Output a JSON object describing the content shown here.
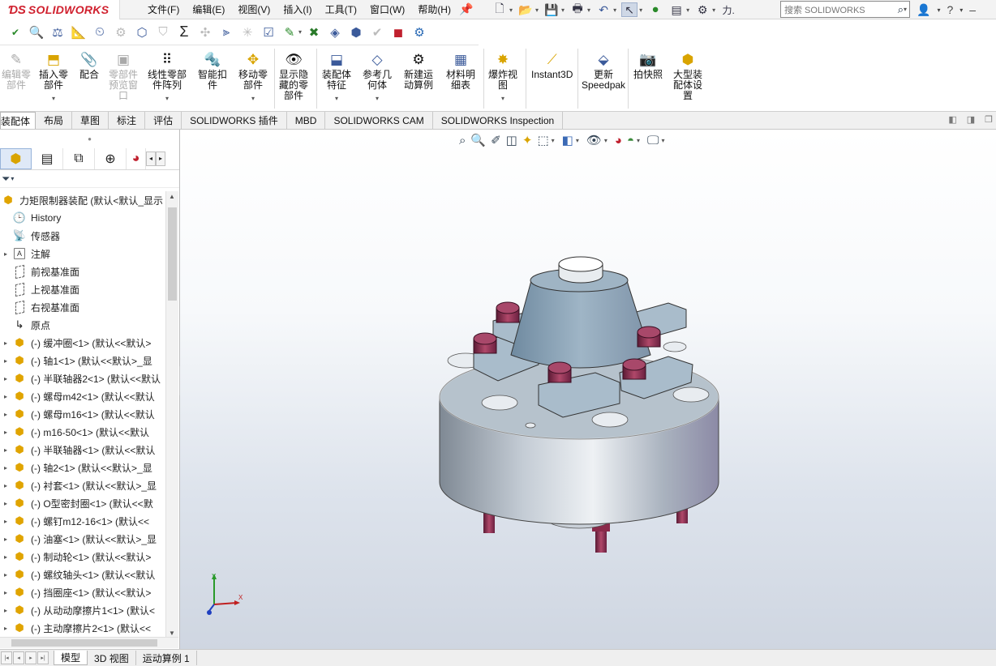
{
  "app": {
    "brand_ds": "ƊS",
    "brand_name": "SOLIDWORKS"
  },
  "menu": [
    "文件(F)",
    "编辑(E)",
    "视图(V)",
    "插入(I)",
    "工具(T)",
    "窗口(W)",
    "帮助(H)"
  ],
  "search": {
    "placeholder": "搜索 SOLIDWORKS"
  },
  "ribbon": {
    "edit_part": "编辑零\n部件",
    "insert_part": "插入零\n部件",
    "mate": "配合",
    "part_preview": "零部件\n预览窗\n口",
    "linear_pattern": "线性零部\n件阵列",
    "smart_fasteners": "智能扣\n件",
    "move_part": "移动零\n部件",
    "show_hidden": "显示隐\n藏的零\n部件",
    "assembly_features": "装配体\n特征",
    "reference_geometry": "参考几\n何体",
    "new_motion_study": "新建运\n动算例",
    "bom": "材料明\n细表",
    "exploded_view": "爆炸视\n图",
    "instant3d": "Instant3D",
    "speedpak": "更新\nSpeedpak",
    "snapshot": "拍快照",
    "large_assembly": "大型装\n配体设\n置"
  },
  "tabs": [
    "装配体",
    "布局",
    "草图",
    "标注",
    "评估",
    "SOLIDWORKS 插件",
    "MBD",
    "SOLIDWORKS CAM",
    "SOLIDWORKS Inspection"
  ],
  "tree": {
    "root": "力矩限制器装配 (默认<默认_显示",
    "items": [
      {
        "label": "History",
        "icon": "history-icon"
      },
      {
        "label": "传感器",
        "icon": "sensor-icon"
      },
      {
        "label": "注解",
        "icon": "annotation-icon"
      },
      {
        "label": "前视基准面",
        "icon": "plane-icon"
      },
      {
        "label": "上视基准面",
        "icon": "plane-icon"
      },
      {
        "label": "右视基准面",
        "icon": "plane-icon"
      },
      {
        "label": "原点",
        "icon": "origin-icon"
      }
    ],
    "parts": [
      "(-) 缓冲圈<1> (默认<<默认>",
      "(-) 轴1<1> (默认<<默认>_显",
      "(-) 半联轴器2<1> (默认<<默认",
      "(-) 螺母m42<1> (默认<<默认",
      "(-) 螺母m16<1> (默认<<默认",
      "(-) m16-50<1> (默认<<默认",
      "(-) 半联轴器<1> (默认<<默认",
      "(-) 轴2<1> (默认<<默认>_显",
      "(-) 衬套<1> (默认<<默认>_显",
      "(-) O型密封圈<1> (默认<<默",
      "(-) 螺钉m12-16<1> (默认<<",
      "(-) 油塞<1> (默认<<默认>_显",
      "(-) 制动轮<1> (默认<<默认>",
      "(-) 螺纹轴头<1> (默认<<默认",
      "(-) 挡圈座<1> (默认<<默认>",
      "(-) 从动动摩擦片1<1> (默认<",
      "(-) 主动摩擦片2<1> (默认<<"
    ]
  },
  "bottom_tabs": [
    "模型",
    "3D 视图",
    "运动算例 1"
  ],
  "triad": {
    "x": "X",
    "y": "Y"
  },
  "colors": {
    "accent": "#d0202e",
    "bolt": "#8a2a4a",
    "body": "#b3bcc6"
  }
}
